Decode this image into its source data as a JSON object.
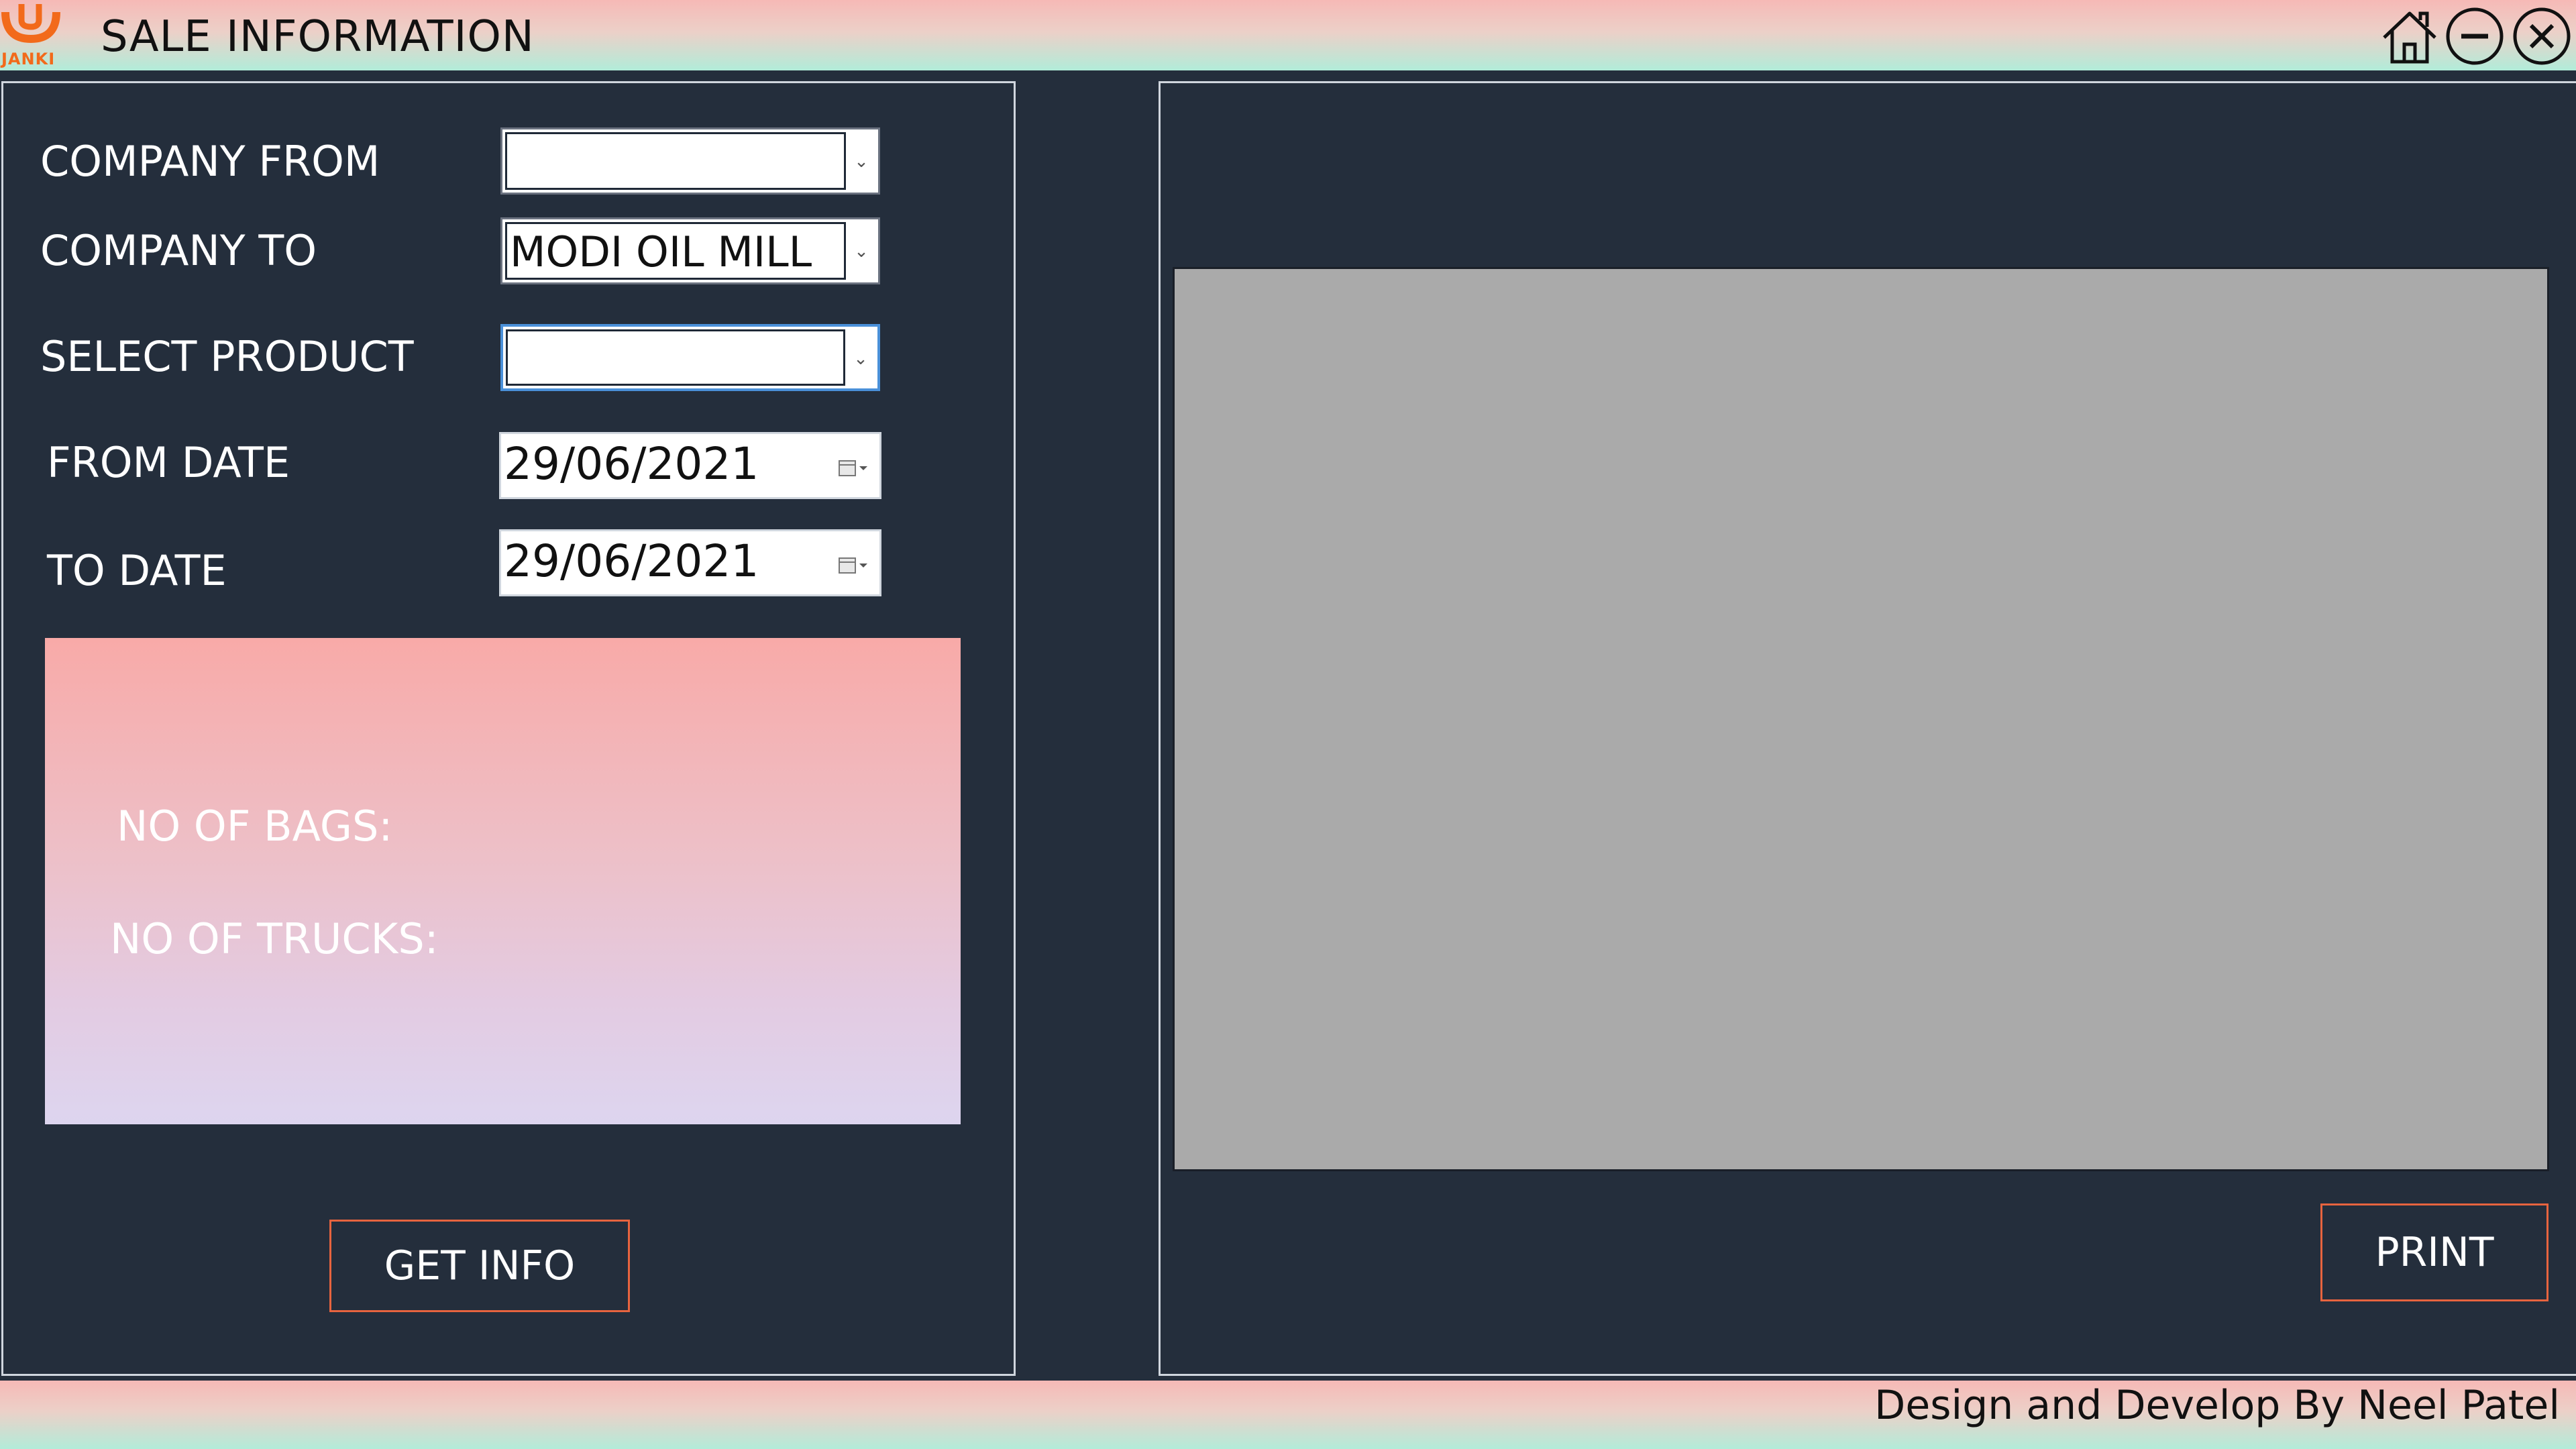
{
  "window": {
    "title": "SALE INFORMATION",
    "logo_text": "JANKI",
    "controls": [
      "home-icon",
      "minimize-icon",
      "close-icon"
    ]
  },
  "form": {
    "company_from": {
      "label": "COMPANY FROM",
      "value": ""
    },
    "company_to": {
      "label": "COMPANY TO",
      "value": "MODI OIL MILL"
    },
    "select_product": {
      "label": "SELECT PRODUCT",
      "value": ""
    },
    "from_date": {
      "label": "FROM DATE",
      "value": "29/06/2021"
    },
    "to_date": {
      "label": "TO DATE",
      "value": "29/06/2021"
    }
  },
  "summary": {
    "bags_label": "NO OF BAGS:",
    "trucks_label": "NO OF TRUCKS:"
  },
  "buttons": {
    "get_info": "GET INFO",
    "print": "PRINT"
  },
  "footer": {
    "credit": "Design and Develop By Neel Patel"
  },
  "colors": {
    "background": "#242e3c",
    "accent_border": "#e7643f",
    "preview": "#aaaaaa",
    "logo": "#f26a1b"
  }
}
